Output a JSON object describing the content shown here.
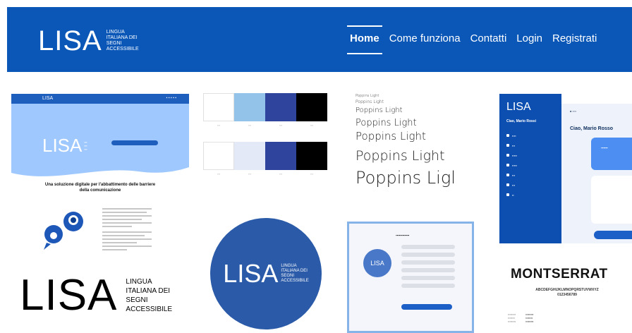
{
  "header": {
    "logo_word": "LISA",
    "logo_sub": [
      "LINGUA",
      "ITALIANA DEI",
      "SEGNI",
      "ACCESSIBILE"
    ],
    "nav": [
      "Home",
      "Come funziona",
      "Contatti",
      "Login",
      "Registrati"
    ],
    "active_nav": "Home",
    "bg_color": "#0a57b8"
  },
  "mockup_landing": {
    "logo": "LISA",
    "tagline": "Una soluzione digitale per l'abbattimento delle barriere della comunicazione"
  },
  "palettes": [
    {
      "colors": [
        "#ffffff",
        "#94c3ea",
        "#2f449c",
        "#000000"
      ]
    },
    {
      "colors": [
        "#ffffff",
        "#e3e9f7",
        "#2f449c",
        "#000000"
      ]
    }
  ],
  "typography_poppins": [
    "Poppins Light",
    "Poppins Light",
    "Poppins Light",
    "Poppins Light",
    "Poppins Light",
    "Poppins Light",
    "Poppins Light",
    "Poppins Ligl"
  ],
  "mockup_dashboard": {
    "logo": "LISA",
    "greeting": "Ciao, Mario Rossi",
    "title": "Ciao, Mario Rosso"
  },
  "big_logo": {
    "word": "LISA",
    "sub": [
      "LINGUA",
      "ITALIANA DEI",
      "SEGNI",
      "ACCESSIBILE"
    ]
  },
  "circle_logo": {
    "word": "LISA",
    "sub": [
      "LINGUA",
      "ITALIANA DEI",
      "SEGNI",
      "ACCESSIBILE"
    ]
  },
  "mockup_register": {
    "logo": "LISA"
  },
  "typography_montserrat": {
    "title": "MONTSERRAT",
    "alphabet": "ABCDEFGHIJKLMNOPQRSTUVWXYZ",
    "digits": "0123456789"
  }
}
